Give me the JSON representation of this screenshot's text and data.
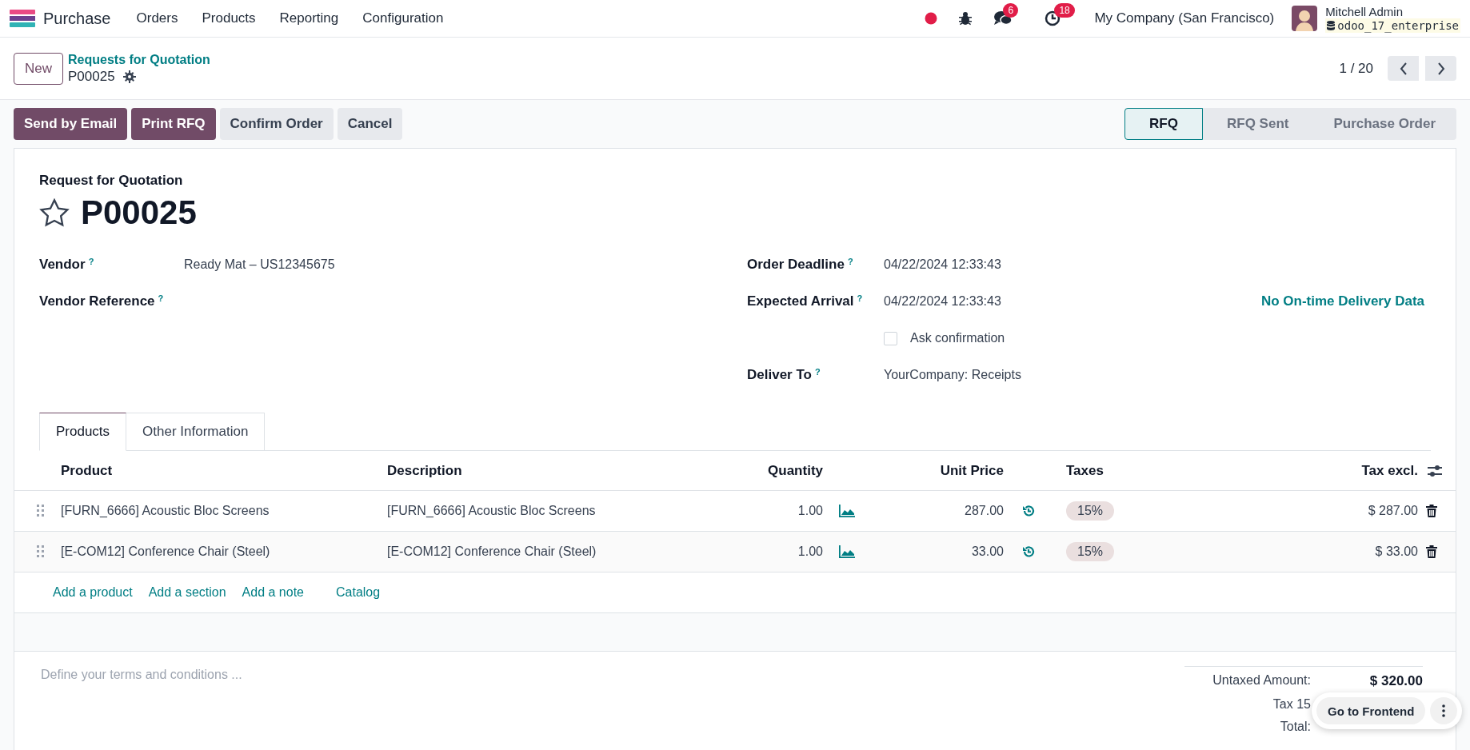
{
  "navbar": {
    "app": "Purchase",
    "menus": [
      "Orders",
      "Products",
      "Reporting",
      "Configuration"
    ],
    "messages_count": "6",
    "activities_count": "18",
    "company": "My Company (San Francisco)",
    "user": "Mitchell Admin",
    "database": "odoo_17_enterprise"
  },
  "control_panel": {
    "new_button": "New",
    "breadcrumb": "Requests for Quotation",
    "record": "P00025",
    "pager": "1 / 20"
  },
  "actions": [
    {
      "label": "Send by Email",
      "kind": "primary"
    },
    {
      "label": "Print RFQ",
      "kind": "primary"
    },
    {
      "label": "Confirm Order",
      "kind": "secondary"
    },
    {
      "label": "Cancel",
      "kind": "secondary"
    }
  ],
  "statusbar": [
    {
      "label": "RFQ",
      "selected": true
    },
    {
      "label": "RFQ Sent",
      "selected": false
    },
    {
      "label": "Purchase Order",
      "selected": false
    }
  ],
  "form": {
    "subtitle": "Request for Quotation",
    "name": "P00025",
    "starred": false,
    "left_fields": [
      {
        "label": "Vendor",
        "help": "?",
        "value": "Ready Mat – US12345675"
      },
      {
        "label": "Vendor Reference",
        "help": "?"
      }
    ],
    "right_fields": [
      {
        "kind": "field",
        "label": "Order Deadline",
        "help": "?",
        "value": "04/22/2024 12:33:43"
      },
      {
        "kind": "field",
        "label": "Expected Arrival",
        "help": "?",
        "value": "04/22/2024 12:33:43",
        "link": "No On-time Delivery Data"
      },
      {
        "kind": "checkbox",
        "label": "Ask confirmation",
        "checked": false
      },
      {
        "kind": "field",
        "label": "Deliver To",
        "help": "?",
        "value": "YourCompany: Receipts"
      }
    ]
  },
  "tabs": [
    {
      "label": "Products",
      "selected": true
    },
    {
      "label": "Other Information",
      "selected": false
    }
  ],
  "table": {
    "columns": [
      "Product",
      "Description",
      "Quantity",
      "Unit Price",
      "Taxes",
      "Tax excl."
    ],
    "rows": [
      {
        "product": "[FURN_6666] Acoustic Bloc Screens",
        "description": "[FURN_6666] Acoustic Bloc Screens",
        "quantity": "1.00",
        "unit_price": "287.00",
        "taxes": "15%",
        "subtotal": "$ 287.00"
      },
      {
        "product": "[E-COM12] Conference Chair (Steel)",
        "description": "[E-COM12] Conference Chair (Steel)",
        "quantity": "1.00",
        "unit_price": "33.00",
        "taxes": "15%",
        "subtotal": "$ 33.00"
      }
    ],
    "add_links": [
      "Add a product",
      "Add a section",
      "Add a note",
      "Catalog"
    ]
  },
  "terms": {
    "placeholder": "Define your terms and conditions ..."
  },
  "totals": [
    {
      "label": "Untaxed Amount:",
      "value": "$ 320.00"
    },
    {
      "label": "Tax 15"
    },
    {
      "label": "Total:"
    }
  ],
  "floating": {
    "button": "Go to Frontend"
  }
}
